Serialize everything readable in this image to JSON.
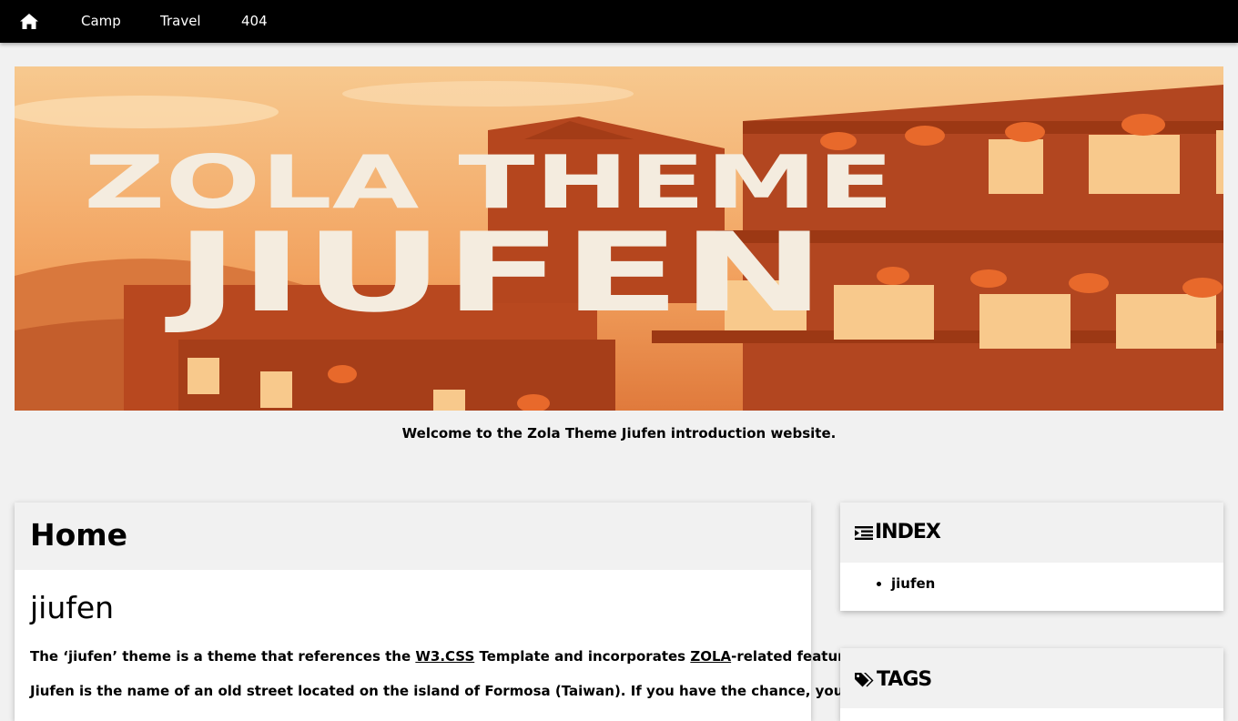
{
  "nav": {
    "home_icon": "home-icon",
    "items": [
      "Camp",
      "Travel",
      "404"
    ]
  },
  "banner": {
    "line1": "ZOLA THEME",
    "line2": "JIUFEN"
  },
  "tagline": "Welcome to the Zola Theme Jiufen introduction website.",
  "main": {
    "title": "Home",
    "post_title": "jiufen",
    "p1_before": "The ‘jiufen’ theme is a theme that references the ",
    "p1_link1": "W3.CSS",
    "p1_middle": " Template and incorporates ",
    "p1_link2": "ZOLA",
    "p1_after": "-related features.",
    "p2": "Jiufen is the name of an old street located on the island of Formosa (Taiwan). If you have the chance, you should definitely"
  },
  "sidebar": {
    "index": {
      "title": "INDEX",
      "icon": "indent-list-icon",
      "items": [
        "jiufen"
      ]
    },
    "tags": {
      "title": "TAGS",
      "icon": "tags-icon"
    }
  },
  "colors": {
    "nav_bg": "#000000",
    "page_bg": "#f1f1f1",
    "banner_orange": "#d9642a"
  }
}
